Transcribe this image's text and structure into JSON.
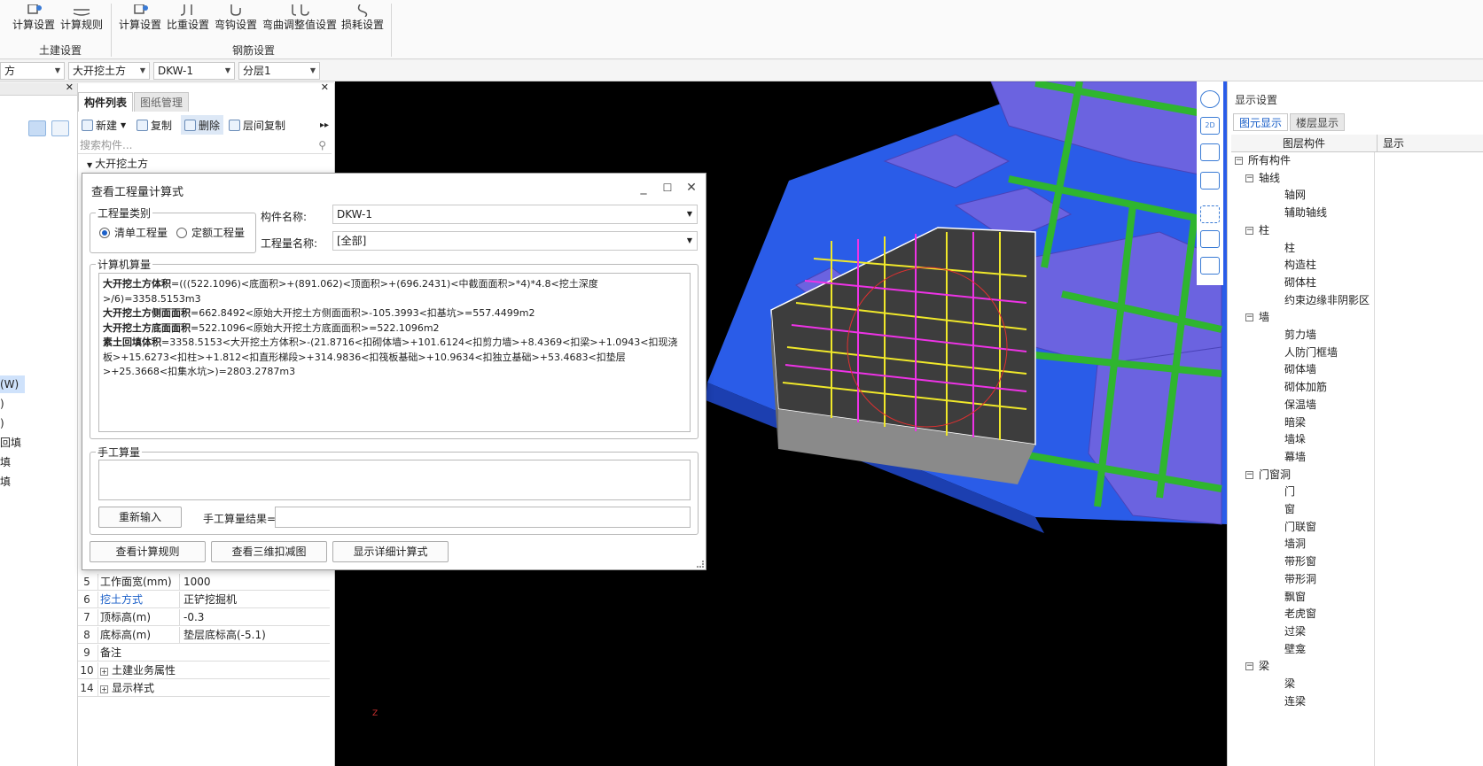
{
  "ribbon": {
    "buttons": [
      {
        "label": "计算设置"
      },
      {
        "label": "计算规则"
      },
      {
        "label": "计算设置"
      },
      {
        "label": "比重设置"
      },
      {
        "label": "弯钩设置"
      },
      {
        "label": "弯曲调整值设置"
      },
      {
        "label": "损耗设置"
      }
    ],
    "groups": [
      {
        "label": "土建设置"
      },
      {
        "label": "钢筋设置"
      }
    ]
  },
  "selectors": [
    "方",
    "大开挖土方",
    "DKW-1",
    "分层1"
  ],
  "left_nav": {
    "items": [
      "(W)",
      ")",
      ")",
      "回填",
      "填",
      "填"
    ]
  },
  "component_list": {
    "tabs": [
      "构件列表",
      "图纸管理"
    ],
    "toolbar": {
      "new": "新建",
      "copy": "复制",
      "delete": "删除",
      "floor_copy": "层间复制"
    },
    "search_placeholder": "搜索构件...",
    "tree_root": "大开挖土方"
  },
  "properties": [
    {
      "no": "5",
      "key": "工作面宽(mm)",
      "value": "1000"
    },
    {
      "no": "6",
      "key": "挖土方式",
      "value": "正铲挖掘机"
    },
    {
      "no": "7",
      "key": "顶标高(m)",
      "value": "-0.3"
    },
    {
      "no": "8",
      "key": "底标高(m)",
      "value": "垫层底标高(-5.1)"
    },
    {
      "no": "9",
      "key": "备注",
      "value": ""
    },
    {
      "no": "10",
      "key": "土建业务属性",
      "value": ""
    },
    {
      "no": "14",
      "key": "显示样式",
      "value": ""
    }
  ],
  "dialog": {
    "title": "查看工程量计算式",
    "category_group": "工程量类别",
    "radio_list": "清单工程量",
    "radio_quota": "定额工程量",
    "component_name_label": "构件名称:",
    "component_name_value": "DKW-1",
    "quantity_name_label": "工程量名称:",
    "quantity_name_value": "[全部]",
    "computer_group": "计算机算量",
    "formulas": [
      {
        "name": "大开挖土方体积",
        "expr": "=(((522.1096)<底面积>+(891.062)<顶面积>+(696.2431)<中截面面积>*4)*4.8<挖土深度>/6)=3358.5153m3"
      },
      {
        "name": "大开挖土方侧面面积",
        "expr": "=662.8492<原始大开挖土方侧面面积>-105.3993<扣基坑>=557.4499m2"
      },
      {
        "name": "大开挖土方底面面积",
        "expr": "=522.1096<原始大开挖土方底面面积>=522.1096m2"
      },
      {
        "name": "素土回填体积",
        "expr": "=3358.5153<大开挖土方体积>-(21.8716<扣砌体墙>+101.6124<扣剪力墙>+8.4369<扣梁>+1.0943<扣现浇板>+15.6273<扣柱>+1.812<扣直形梯段>+314.9836<扣筏板基础>+10.9634<扣独立基础>+53.4683<扣垫层>+25.3668<扣集水坑>)=2803.2787m3"
      }
    ],
    "manual_group": "手工算量",
    "reinput_button": "重新输入",
    "manual_result_label": "手工算量结果=",
    "view_rules_button": "查看计算规则",
    "view_3d_button": "查看三维扣减图",
    "show_detail_button": "显示详细计算式"
  },
  "right_panel": {
    "title": "显示设置",
    "tabs": [
      "图元显示",
      "楼层显示"
    ],
    "header_col1": "图层构件",
    "header_col2": "显示",
    "layers": [
      {
        "label": "所有构件",
        "level": 0,
        "box": "−"
      },
      {
        "label": "轴线",
        "level": 1,
        "box": "−"
      },
      {
        "label": "轴网",
        "level": 2,
        "box": ""
      },
      {
        "label": "辅助轴线",
        "level": 2,
        "box": ""
      },
      {
        "label": "柱",
        "level": 1,
        "box": "−"
      },
      {
        "label": "柱",
        "level": 2,
        "box": ""
      },
      {
        "label": "构造柱",
        "level": 2,
        "box": ""
      },
      {
        "label": "砌体柱",
        "level": 2,
        "box": ""
      },
      {
        "label": "约束边缘非阴影区",
        "level": 2,
        "box": ""
      },
      {
        "label": "墙",
        "level": 1,
        "box": "−"
      },
      {
        "label": "剪力墙",
        "level": 2,
        "box": ""
      },
      {
        "label": "人防门框墙",
        "level": 2,
        "box": ""
      },
      {
        "label": "砌体墙",
        "level": 2,
        "box": ""
      },
      {
        "label": "砌体加筋",
        "level": 2,
        "box": ""
      },
      {
        "label": "保温墙",
        "level": 2,
        "box": ""
      },
      {
        "label": "暗梁",
        "level": 2,
        "box": ""
      },
      {
        "label": "墙垛",
        "level": 2,
        "box": ""
      },
      {
        "label": "幕墙",
        "level": 2,
        "box": ""
      },
      {
        "label": "门窗洞",
        "level": 1,
        "box": "−"
      },
      {
        "label": "门",
        "level": 2,
        "box": ""
      },
      {
        "label": "窗",
        "level": 2,
        "box": ""
      },
      {
        "label": "门联窗",
        "level": 2,
        "box": ""
      },
      {
        "label": "墙洞",
        "level": 2,
        "box": ""
      },
      {
        "label": "带形窗",
        "level": 2,
        "box": ""
      },
      {
        "label": "带形洞",
        "level": 2,
        "box": ""
      },
      {
        "label": "飘窗",
        "level": 2,
        "box": ""
      },
      {
        "label": "老虎窗",
        "level": 2,
        "box": ""
      },
      {
        "label": "过梁",
        "level": 2,
        "box": ""
      },
      {
        "label": "壁龛",
        "level": 2,
        "box": ""
      },
      {
        "label": "梁",
        "level": 1,
        "box": "−"
      },
      {
        "label": "梁",
        "level": 2,
        "box": ""
      },
      {
        "label": "连梁",
        "level": 2,
        "box": ""
      }
    ]
  },
  "viewport": {
    "axis_label": "Z",
    "view_tools": [
      "orbit-icon",
      "2D",
      "cube-icon",
      "cube-icon",
      "fit-icon",
      "layer-icon",
      "list-icon"
    ],
    "view_tool_2d": "2D"
  },
  "colors": {
    "viewport_bg": "#000000",
    "slab_blue": "#2a5ce8",
    "footing_purple": "#6b63e0",
    "beam_green": "#2fb52f",
    "rebar_yellow": "#f0e82a",
    "rebar_magenta": "#ee33e6",
    "accent_blue": "#1a5fc8"
  }
}
